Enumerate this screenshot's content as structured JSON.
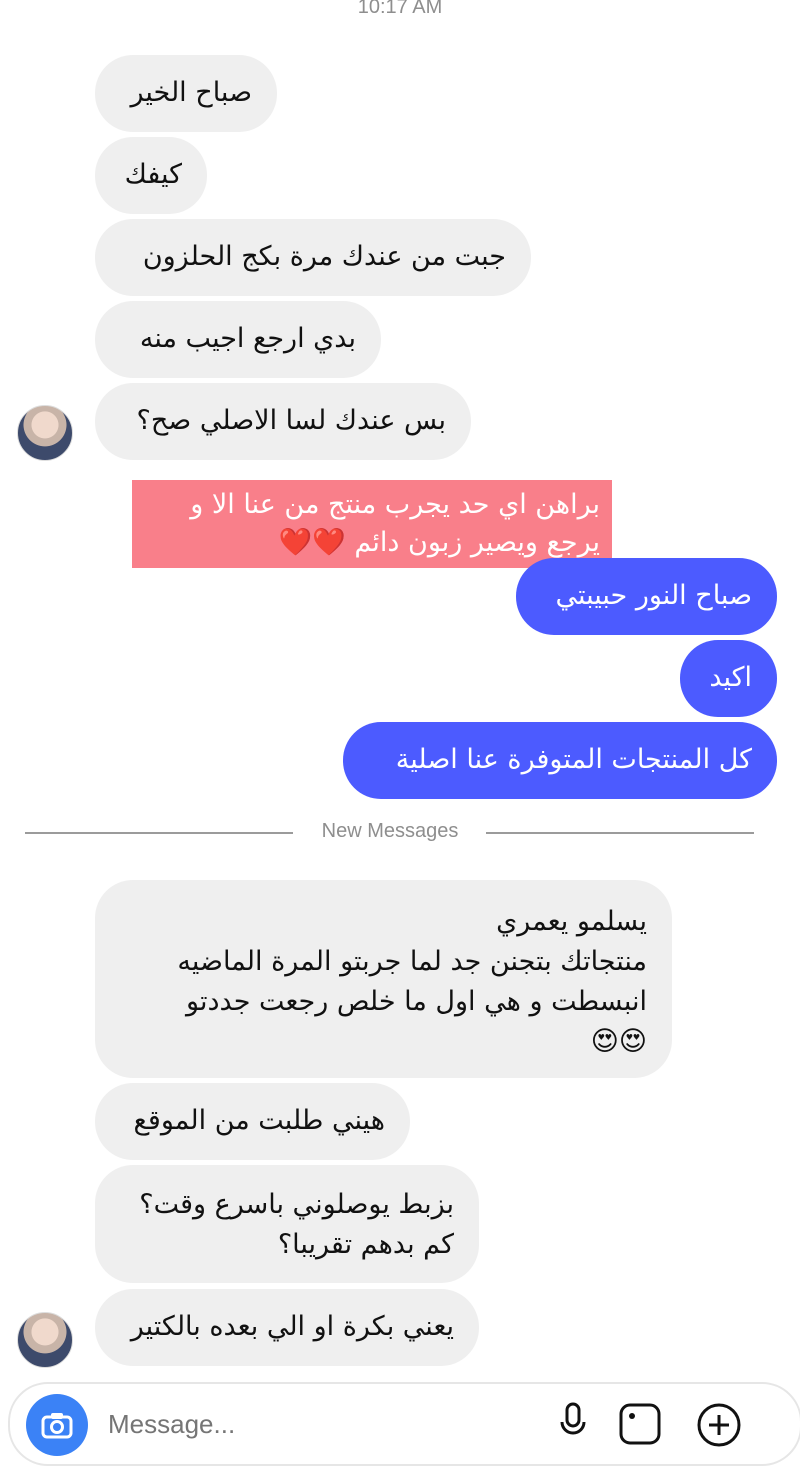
{
  "status": {
    "time": "10:17 AM"
  },
  "messages_before": [
    {
      "text": "صباح الخير"
    },
    {
      "text": "كيفك"
    },
    {
      "text": "جبت من عندك مرة بكج الحلزون"
    },
    {
      "text": "بدي ارجع اجيب منه"
    },
    {
      "text": "بس عندك لسا الاصلي صح؟"
    }
  ],
  "overlay_caption": {
    "line1": "براهن اي حد يجرب منتج من عنا الا و",
    "line2": "يرجع  ويصير زبون دائم",
    "hearts": "❤️❤️"
  },
  "messages_outgoing": [
    {
      "text": "صباح النور حبيبتي"
    },
    {
      "text": "اكيد"
    },
    {
      "text": "كل المنتجات المتوفرة عنا اصلية"
    }
  ],
  "divider": {
    "label": "New Messages"
  },
  "messages_after": [
    {
      "lines": [
        "يسلمو يعمري",
        "منتجاتك بتجنن جد لما جربتو المرة الماضيه",
        "انبسطت و هي اول ما خلص رجعت جددتو",
        "😍😍"
      ]
    },
    {
      "lines": [
        "هيني طلبت من الموقع"
      ]
    },
    {
      "lines": [
        "بزبط يوصلوني باسرع وقت؟",
        "كم بدهم تقريبا؟"
      ]
    },
    {
      "lines": [
        "يعني بكرة او الي بعده بالكتير"
      ]
    }
  ],
  "composer": {
    "placeholder": "Message..."
  },
  "icons": {
    "camera": "camera-icon",
    "mic": "microphone-icon",
    "gallery": "gallery-icon",
    "add": "plus-circle-icon"
  },
  "colors": {
    "incoming_bubble": "#efefef",
    "outgoing_bubble": "#4c5bff",
    "sticker_bg": "#f97f8a",
    "camera_button": "#3b82f6"
  }
}
